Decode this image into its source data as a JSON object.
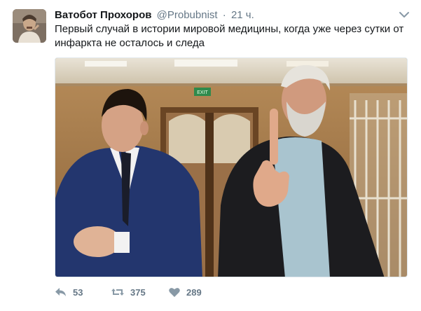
{
  "tweet": {
    "author_name": "Ватобот Прохоров",
    "handle": "@Probubnist",
    "separator": "·",
    "time": "21 ч.",
    "text": "Первый случай в истории мировой медицины, когда уже через сутки от инфаркта не осталось и следа",
    "media": {
      "exit_sign": "EXIT"
    },
    "actions": {
      "reply_count": "53",
      "retweet_count": "375",
      "like_count": "289"
    }
  },
  "icons": {
    "caret": "chevron-down-icon",
    "reply": "reply-icon",
    "retweet": "retweet-icon",
    "like": "heart-icon"
  },
  "colors": {
    "text": "#14171a",
    "muted": "#657786",
    "border": "#e1e8ed",
    "background": "#ffffff"
  }
}
